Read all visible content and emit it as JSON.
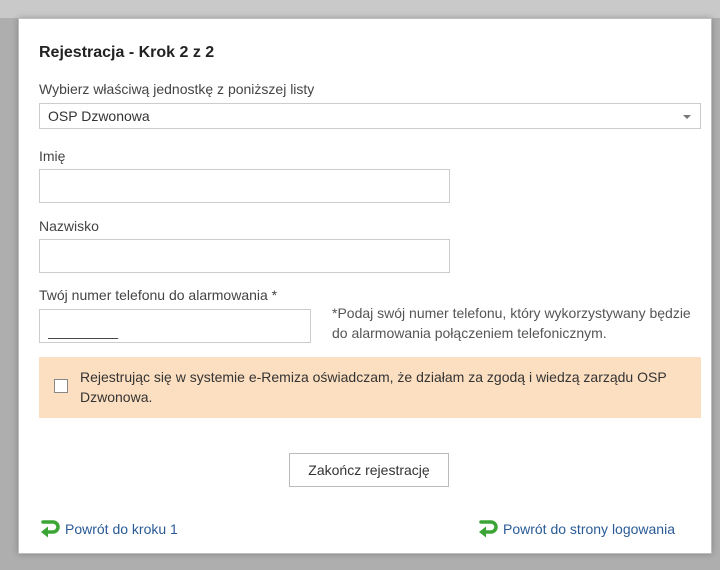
{
  "form": {
    "title": "Rejestracja - Krok 2 z 2",
    "unit_label": "Wybierz właściwą jednostkę z poniższej listy",
    "unit_selected": "OSP Dzwonowa",
    "first_name_label": "Imię",
    "first_name_value": "",
    "last_name_label": "Nazwisko",
    "last_name_value": "",
    "phone_label": "Twój numer telefonu do alarmowania *",
    "phone_value": "_________",
    "phone_hint": "*Podaj swój numer telefonu, który wykorzystywany będzie do alarmowania połączeniem telefonicznym.",
    "consent_text": "Rejestrując się w systemie e-Remiza oświadczam, że działam za zgodą i wiedzą zarządu OSP Dzwonowa.",
    "consent_checked": false,
    "submit_label": "Zakończ rejestrację"
  },
  "links": {
    "back_step": "Powrót do kroku 1",
    "back_login": "Powrót do strony logowania"
  },
  "colors": {
    "notice_bg": "#fcdfc1",
    "link": "#2a5a96",
    "icon_green": "#3aa535"
  }
}
